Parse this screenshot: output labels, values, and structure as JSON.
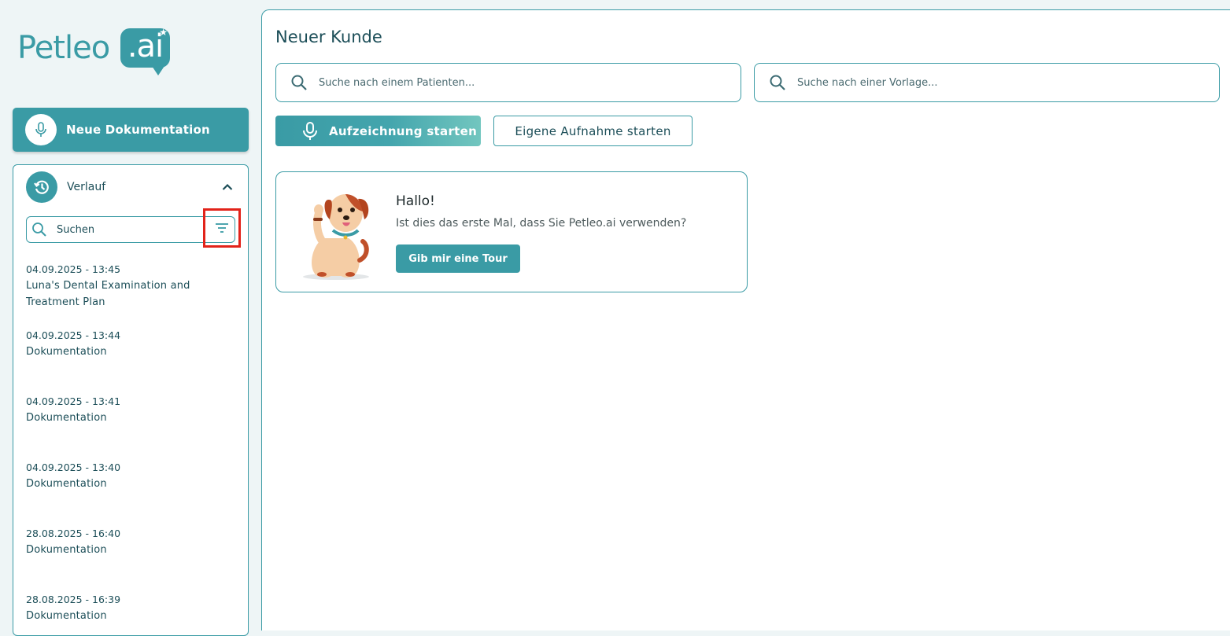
{
  "colors": {
    "accent": "#3a9ba5",
    "text": "#1c4e58",
    "highlight": "#e2231a"
  },
  "logo": {
    "text": "Petleo",
    "badge": ".ai"
  },
  "sidebar": {
    "new_doc_label": "Neue Dokumentation",
    "new_doc_icon": "microphone-icon",
    "history": {
      "title": "Verlauf",
      "icon": "history-icon",
      "search_placeholder": "Suchen",
      "items": [
        {
          "date": "04.09.2025 - 13:45",
          "name": "Luna's Dental Examination and Treatment Plan"
        },
        {
          "date": "04.09.2025 - 13:44",
          "name": "Dokumentation"
        },
        {
          "date": "04.09.2025 - 13:41",
          "name": "Dokumentation"
        },
        {
          "date": "04.09.2025 - 13:40",
          "name": "Dokumentation"
        },
        {
          "date": "28.08.2025 - 16:40",
          "name": "Dokumentation"
        },
        {
          "date": "28.08.2025 - 16:39",
          "name": "Dokumentation"
        }
      ]
    }
  },
  "main": {
    "title": "Neuer Kunde",
    "patient_search_placeholder": "Suche nach einem Patienten...",
    "template_search_placeholder": "Suche nach einer Vorlage...",
    "record_button": "Aufzeichnung starten",
    "own_record_button": "Eigene Aufnahme starten",
    "welcome": {
      "title": "Hallo!",
      "text": "Ist dies das erste Mal, dass Sie Petleo.ai verwenden?",
      "button": "Gib mir eine Tour"
    }
  }
}
